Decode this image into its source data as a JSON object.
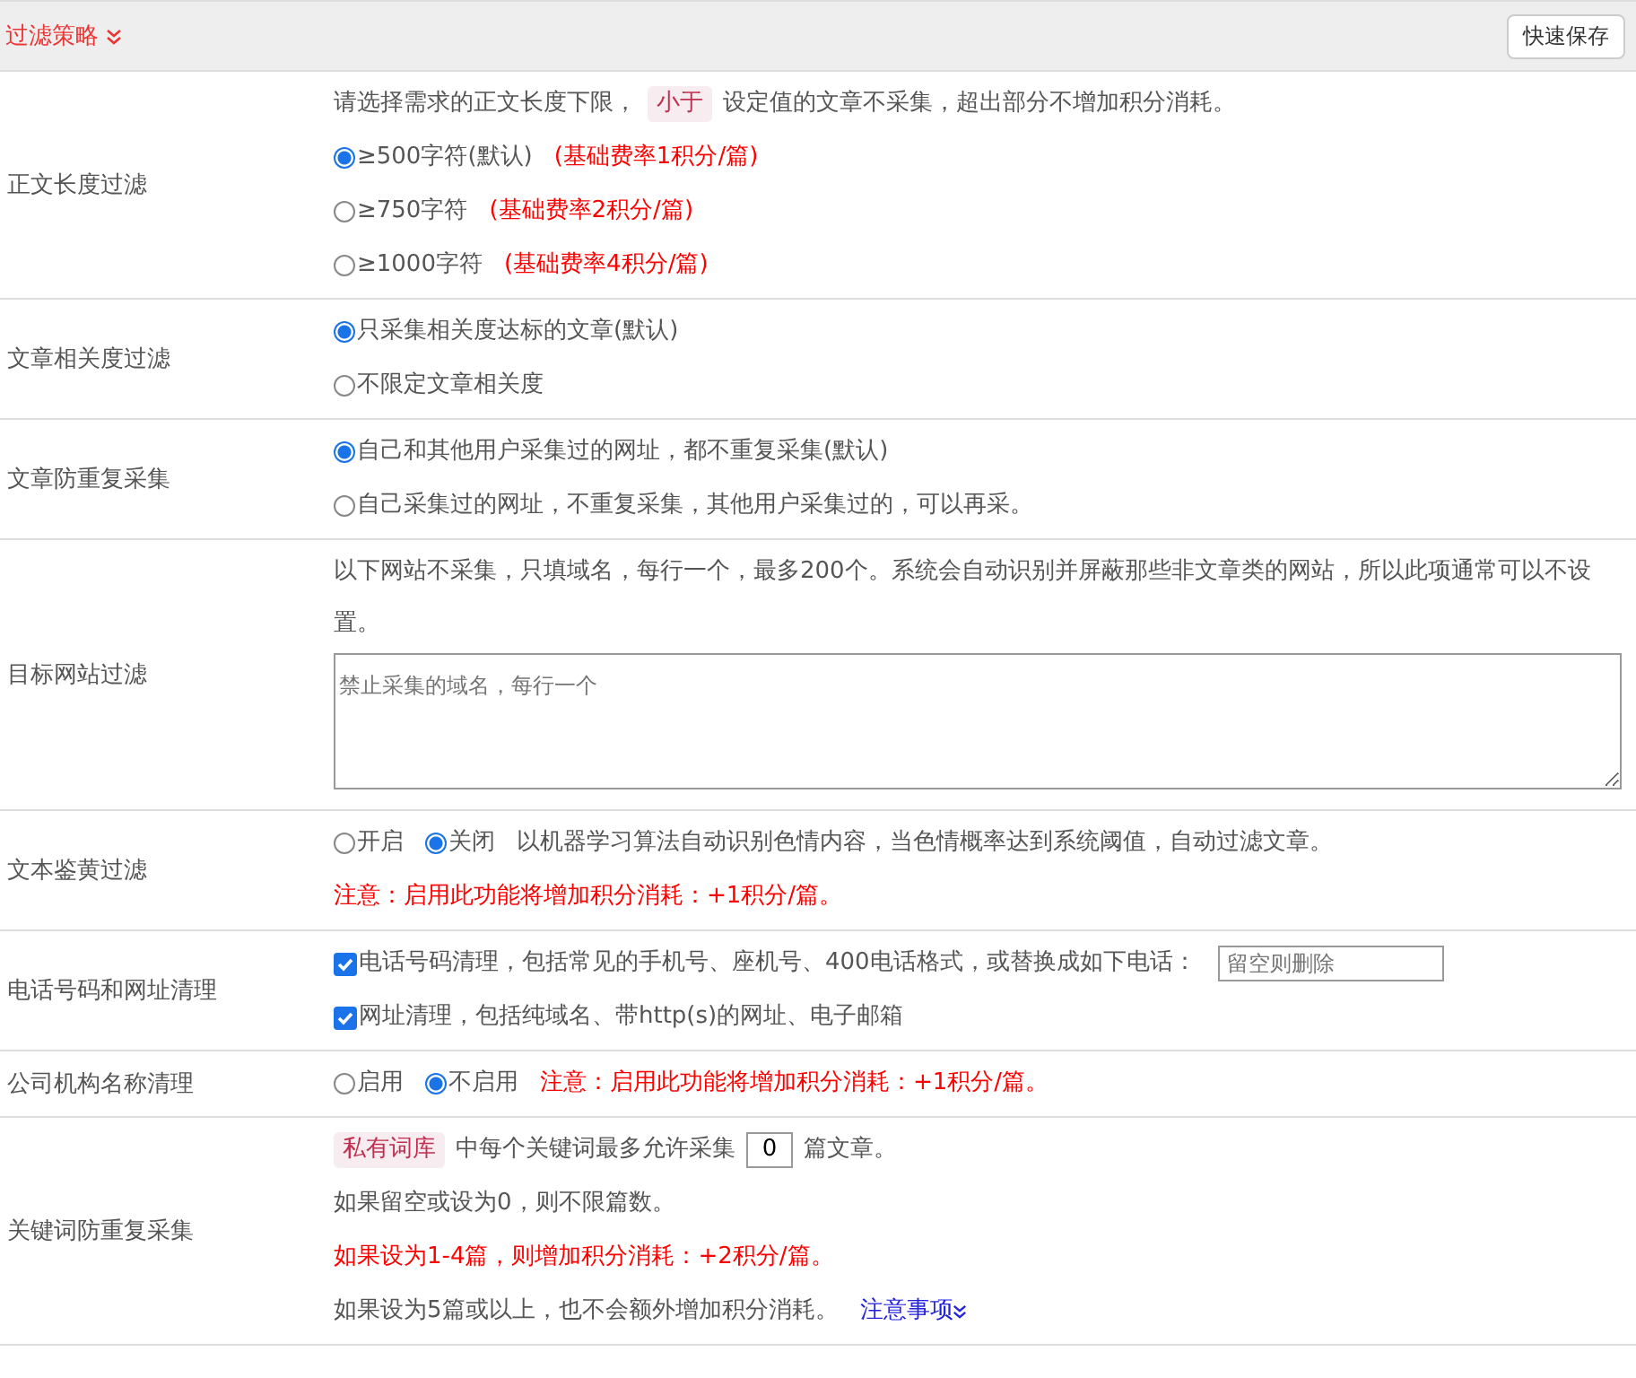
{
  "header": {
    "title": "过滤策略",
    "button": "快速保存"
  },
  "rows": [
    {
      "label": "正文长度过滤",
      "lines": [
        [
          {
            "kind": "text",
            "text": "请选择需求的正文长度下限，"
          },
          {
            "kind": "tag",
            "text": "小于"
          },
          {
            "kind": "text",
            "text": "设定值的文章不采集，超出部分不增加积分消耗。"
          }
        ],
        [
          {
            "kind": "radio",
            "text": "≥500字符(默认)",
            "selected": true
          },
          {
            "kind": "note",
            "text": "(基础费率1积分/篇)"
          }
        ],
        [
          {
            "kind": "radio",
            "text": "≥750字符",
            "selected": false
          },
          {
            "kind": "note",
            "text": "(基础费率2积分/篇)"
          }
        ],
        [
          {
            "kind": "radio",
            "text": "≥1000字符",
            "selected": false
          },
          {
            "kind": "note",
            "text": "(基础费率4积分/篇)"
          }
        ]
      ]
    },
    {
      "label": "文章相关度过滤",
      "lines": [
        [
          {
            "kind": "radio",
            "text": "只采集相关度达标的文章(默认)",
            "selected": true
          }
        ],
        [
          {
            "kind": "radio",
            "text": "不限定文章相关度",
            "selected": false
          }
        ]
      ]
    },
    {
      "label": "文章防重复采集",
      "lines": [
        [
          {
            "kind": "radio",
            "text": "自己和其他用户采集过的网址，都不重复采集(默认)",
            "selected": true
          }
        ],
        [
          {
            "kind": "radio",
            "text": "自己采集过的网址，不重复采集，其他用户采集过的，可以再采。",
            "selected": false
          }
        ]
      ]
    },
    {
      "label": "目标网站过滤",
      "lines": [
        [
          {
            "kind": "text",
            "text": "以下网站不采集，只填域名，每行一个，最多200个。系统会自动识别并屏蔽那些非文章类的网站，所以此项通常可以不设置。"
          }
        ],
        [
          {
            "kind": "textarea",
            "placeholder": "禁止采集的域名，每行一个"
          }
        ]
      ]
    },
    {
      "label": "文本鉴黄过滤",
      "lines": [
        [
          {
            "kind": "radio",
            "text": "开启",
            "selected": false
          },
          {
            "kind": "radio",
            "text": "关闭",
            "selected": true
          },
          {
            "kind": "text",
            "text": "以机器学习算法自动识别色情内容，当色情概率达到系统阈值，自动过滤文章。"
          }
        ],
        [
          {
            "kind": "note",
            "text": "注意：启用此功能将增加积分消耗：+1积分/篇。"
          }
        ]
      ]
    },
    {
      "label": "电话号码和网址清理",
      "lines": [
        [
          {
            "kind": "checkbox",
            "text": "电话号码清理，包括常见的手机号、座机号、400电话格式，或替换成如下电话：",
            "checked": true
          },
          {
            "kind": "input",
            "placeholder": "留空则删除"
          }
        ],
        [
          {
            "kind": "checkbox",
            "text": "网址清理，包括纯域名、带http(s)的网址、电子邮箱",
            "checked": true
          }
        ]
      ]
    },
    {
      "label": "公司机构名称清理",
      "lines": [
        [
          {
            "kind": "radio",
            "text": "启用",
            "selected": false
          },
          {
            "kind": "radio",
            "text": "不启用",
            "selected": true
          },
          {
            "kind": "note",
            "text": "注意：启用此功能将增加积分消耗：+1积分/篇。"
          }
        ]
      ]
    },
    {
      "label": "关键词防重复采集",
      "lines": [
        [
          {
            "kind": "tag",
            "text": "私有词库"
          },
          {
            "kind": "text",
            "text": "中每个关键词最多允许采集"
          },
          {
            "kind": "number",
            "value": "0"
          },
          {
            "kind": "text",
            "text": "篇文章。"
          }
        ],
        [
          {
            "kind": "text",
            "text": "如果留空或设为0，则不限篇数。"
          }
        ],
        [
          {
            "kind": "note",
            "text": "如果设为1-4篇，则增加积分消耗：+2积分/篇。"
          }
        ],
        [
          {
            "kind": "text",
            "text": "如果设为5篇或以上，也不会额外增加积分消耗。"
          },
          {
            "kind": "link",
            "text": "注意事项"
          }
        ]
      ]
    }
  ]
}
